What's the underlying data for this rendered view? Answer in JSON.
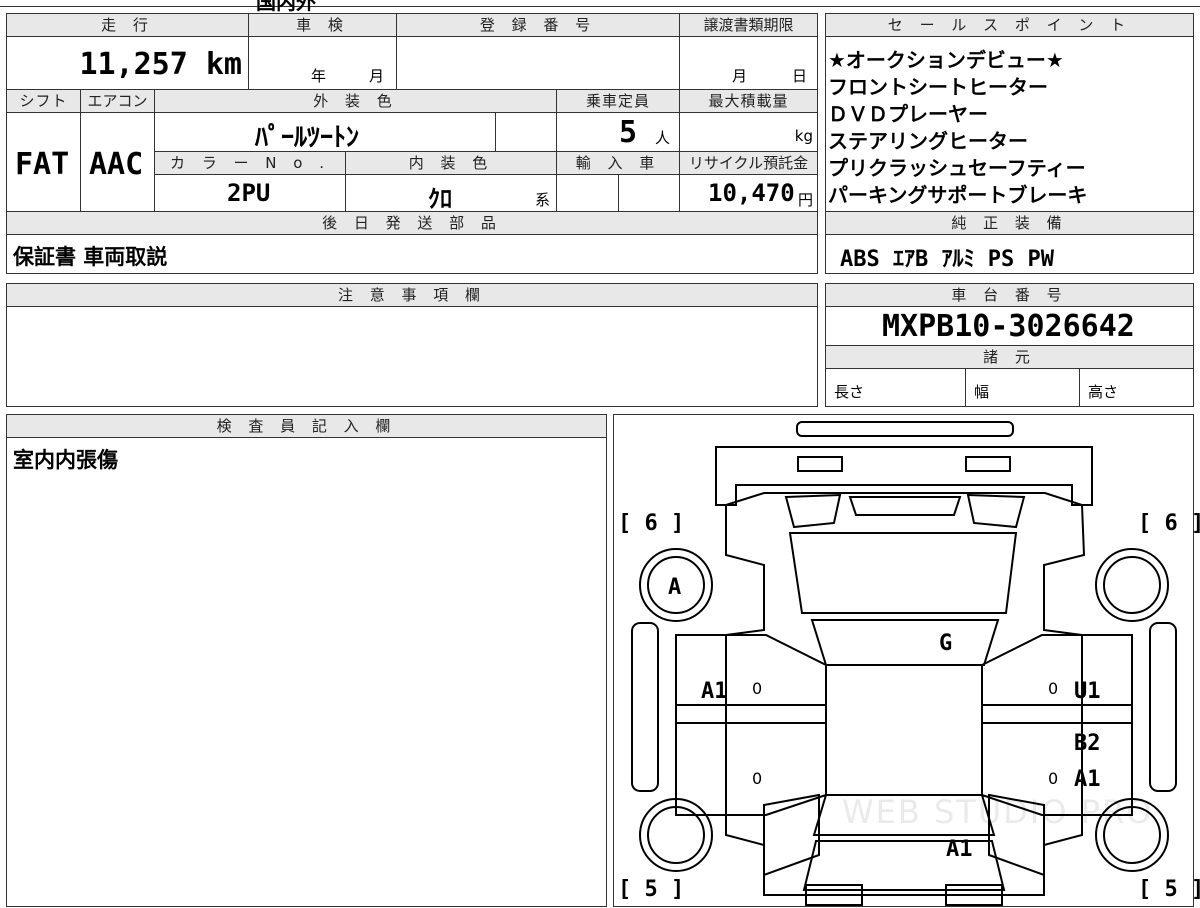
{
  "top_partial": "国内外",
  "headers": {
    "mileage": "走 行",
    "shaken": "車 検",
    "reg_no": "登 録 番 号",
    "transfer_deadline": "譲渡書類期限",
    "shift": "シフト",
    "aircon": "エアコン",
    "exterior": "外 装 色",
    "capacity": "乗車定員",
    "max_load": "最大積載量",
    "color_no": "カ ラ ー N o .",
    "interior": "内 装 色",
    "import": "輸 入 車",
    "recycle": "リサイクル預託金",
    "later_parts": "後 日 発 送 部 品",
    "sales_points": "セ ー ル ス ポ イ ン ト",
    "genuine_equipment": "純 正 装 備",
    "notes": "注 意 事 項 欄",
    "chassis_no": "車 台 番 号",
    "specs": "諸 元",
    "inspector": "検 査 員 記 入 欄"
  },
  "vehicle": {
    "mileage": "11,257 km",
    "shaken_year": "年",
    "shaken_month": "月",
    "deadline_month": "月",
    "deadline_day": "日",
    "shift": "FAT",
    "aircon": "AAC",
    "exterior_color": "ﾊﾟｰﾙﾂｰﾄﾝ",
    "capacity_value": "5",
    "capacity_unit": "人",
    "max_load_unit": "kg",
    "color_no": "2PU",
    "interior_color": "ｸﾛ",
    "interior_suffix": "系",
    "recycle_value": "10,470",
    "recycle_unit": "円",
    "later_parts": "保証書 車両取説",
    "chassis_no": "MXPB10-3026642",
    "spec_length": "長さ",
    "spec_width": "幅",
    "spec_height": "高さ"
  },
  "sales_points": [
    "★オークションデビュー★",
    "フロントシートヒーター",
    "ＤＶＤプレーヤー",
    "ステアリングヒーター",
    "プリクラッシュセーフティー",
    "パーキングサポートブレーキ"
  ],
  "genuine_equipment": "ABS ｴｱB ｱﾙﾐ PS PW",
  "inspector_note": "室内内張傷",
  "diagram": {
    "tire_fl": "[ 6 ]",
    "tire_fr": "[ 6 ]",
    "tire_rl": "[ 5 ]",
    "tire_rr": "[ 5 ]",
    "mark_front_left": "A",
    "mark_windshield": "G",
    "mark_left_front_door": "A1",
    "mark_right_front_door": "U1",
    "mark_right_rear_upper": "B2",
    "mark_right_rear_door": "A1",
    "mark_rear": "A1",
    "zero_a": "0",
    "zero_b": "0",
    "zero_c": "0",
    "zero_d": "0",
    "watermark": "WEB STUDIO PRO"
  }
}
